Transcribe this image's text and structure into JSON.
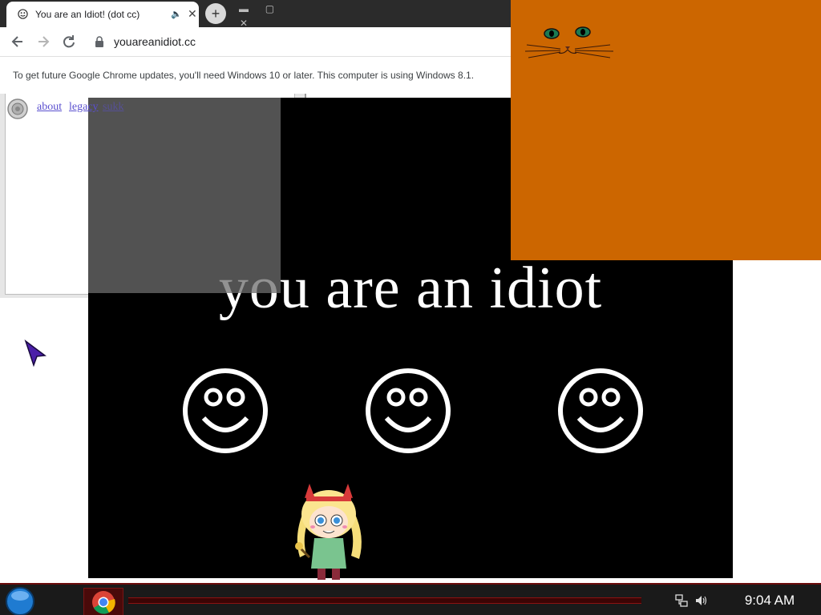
{
  "browser": {
    "tab_title": "You are an Idiot! (dot cc)",
    "audio_indicator": "🔈",
    "tab_close": "✕",
    "new_tab": "+",
    "url": "youareanidiot.cc",
    "infobar_message": "To get future Google Chrome updates, you'll need Windows 10 or later. This computer is using Windows 8.1."
  },
  "page": {
    "links": [
      "about",
      "legacy",
      "sukk"
    ],
    "headline": "you are an idiot"
  },
  "taskbar": {
    "clock": "9:04 AM"
  },
  "colors": {
    "cat_window": "#cc6600",
    "idiot_window": "#000000",
    "taskbar_accent": "#8a1212"
  },
  "icons": [
    "smiley-icon",
    "lock-icon",
    "back-arrow-icon",
    "forward-arrow-icon",
    "reload-icon",
    "speaker-icon",
    "chrome-icon",
    "network-icon",
    "volume-icon",
    "start-orb-icon"
  ]
}
